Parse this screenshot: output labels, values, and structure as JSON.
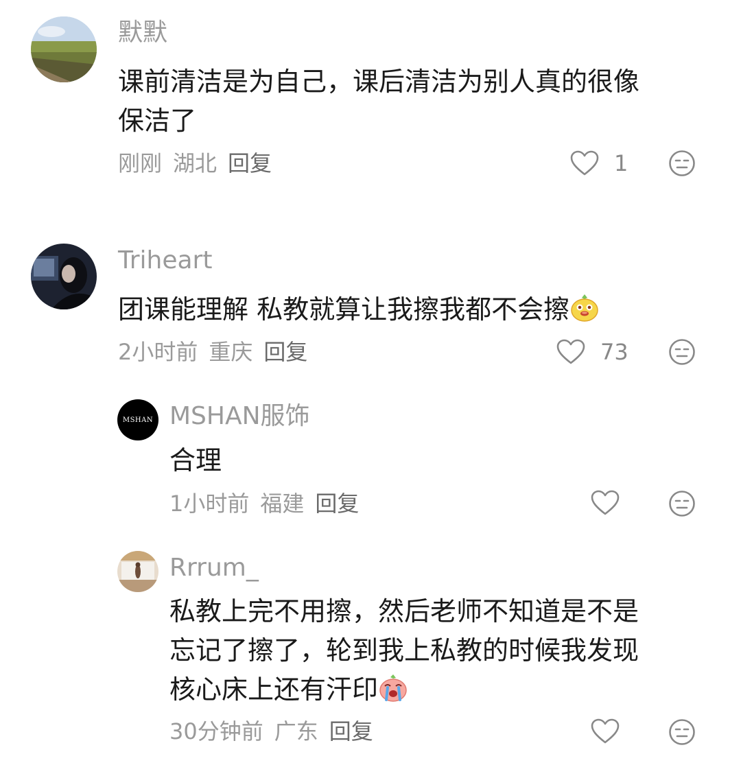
{
  "comments": [
    {
      "username": "默默",
      "lines": [
        "课前清洁是为自己，课后清洁为别人真的很像",
        "保洁了"
      ],
      "time": "刚刚",
      "location": "湖北",
      "reply_label": "回复",
      "likes": "1"
    },
    {
      "username": "Triheart",
      "lines": [
        "团课能理解 私教就算让我擦我都不会擦"
      ],
      "emoji": "yellow-cute-face-emoji",
      "time": "2小时前",
      "location": "重庆",
      "reply_label": "回复",
      "likes": "73",
      "replies": [
        {
          "username": "MSHAN服饰",
          "avatar_text": "MSHAN",
          "lines": [
            "合理"
          ],
          "time": "1小时前",
          "location": "福建",
          "reply_label": "回复"
        },
        {
          "username": "Rrrum_",
          "lines": [
            "私教上完不用擦，然后老师不知道是不是",
            "忘记了擦了，轮到我上私教的时候我发现",
            "核心床上还有汗印"
          ],
          "emoji": "crying-pink-face-emoji",
          "time": "30分钟前",
          "location": "广东",
          "reply_label": "回复"
        }
      ]
    }
  ],
  "colors": {
    "text": "#1a1a1a",
    "meta": "#9a9a9a",
    "icon": "#888888"
  }
}
